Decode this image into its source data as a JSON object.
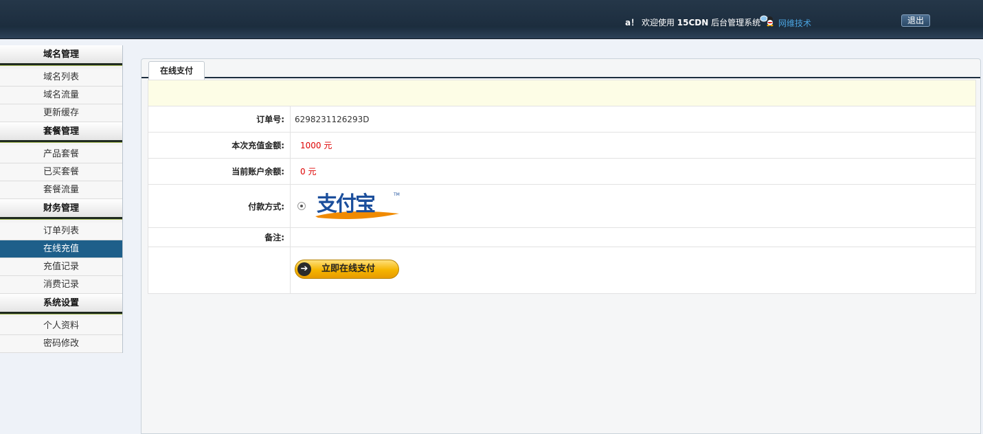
{
  "header": {
    "welcome_user": "a！",
    "welcome_prefix": "欢迎使用",
    "system_name": "15CDN",
    "system_suffix": "后台管理系统",
    "support_link": "网维技术",
    "logout_label": "退出"
  },
  "sidebar": {
    "groups": [
      {
        "title": "域名管理",
        "items": [
          "域名列表",
          "域名流量",
          "更新缓存"
        ]
      },
      {
        "title": "套餐管理",
        "items": [
          "产品套餐",
          "已买套餐",
          "套餐流量"
        ]
      },
      {
        "title": "财务管理",
        "items": [
          "订单列表",
          "在线充值",
          "充值记录",
          "消费记录"
        ]
      },
      {
        "title": "系统设置",
        "items": [
          "个人资料",
          "密码修改"
        ]
      }
    ],
    "active_item": "在线充值"
  },
  "main": {
    "tab_label": "在线支付",
    "form": {
      "order_no_label": "订单号:",
      "order_no": "6298231126293D",
      "amount_label": "本次充值金额:",
      "amount": "1000 元",
      "balance_label": "当前账户余额:",
      "balance": "0 元",
      "payment_label": "付款方式:",
      "payment_option": "alipay",
      "remark_label": "备注:",
      "remark": "",
      "submit_label": "立即在线支付"
    }
  },
  "colors": {
    "accent_active": "#1e5f8a",
    "amount_red": "#dd0000",
    "button_gold": "#f5b400"
  }
}
